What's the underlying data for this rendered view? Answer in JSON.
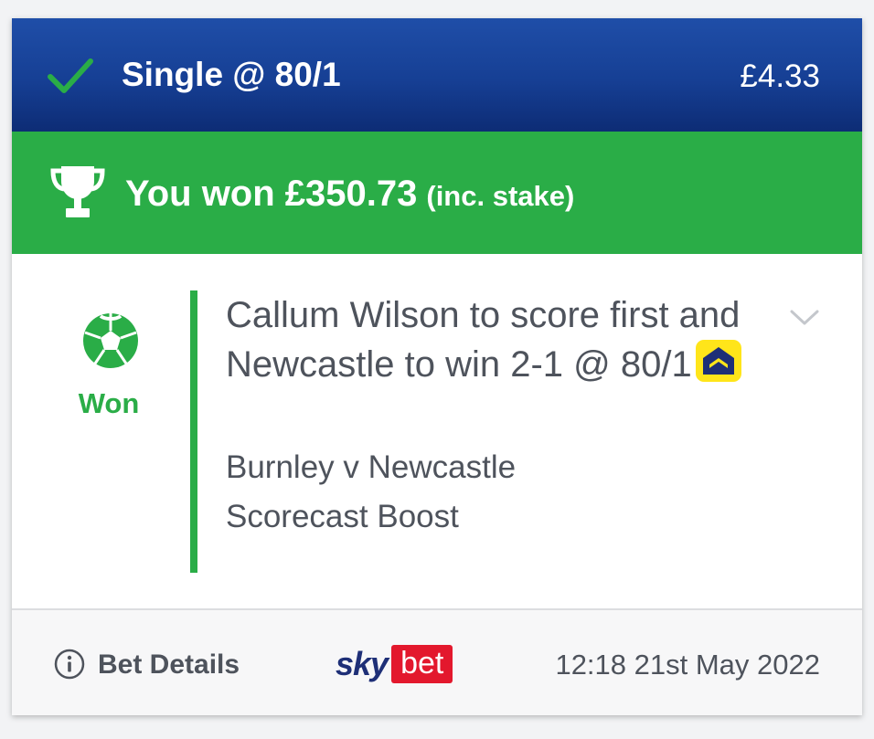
{
  "header": {
    "bet_type": "Single @ 80/1",
    "stake": "£4.33",
    "icon": "check-icon"
  },
  "win_banner": {
    "message": "You won £350.73",
    "note": "(inc. stake)",
    "icon": "trophy-icon"
  },
  "selection": {
    "result": "Won",
    "sport_icon": "football-icon",
    "title": "Callum Wilson to score first and Newcastle to win 2-1 @ 80/1",
    "boost_icon": "price-boost-icon",
    "event": "Burnley v Newcastle",
    "market": "Scorecast Boost",
    "expand_icon": "chevron-down-icon"
  },
  "footer": {
    "details_label": "Bet Details",
    "info_icon": "info-icon",
    "brand_sky": "sky",
    "brand_bet": "bet",
    "timestamp": "12:18 21st May 2022"
  },
  "colors": {
    "header_blue": "#163f94",
    "win_green": "#2aad47",
    "text_grey": "#4e535c",
    "boost_yellow": "#ffe51a",
    "brand_red": "#e3182d",
    "brand_navy": "#1e2f77"
  }
}
